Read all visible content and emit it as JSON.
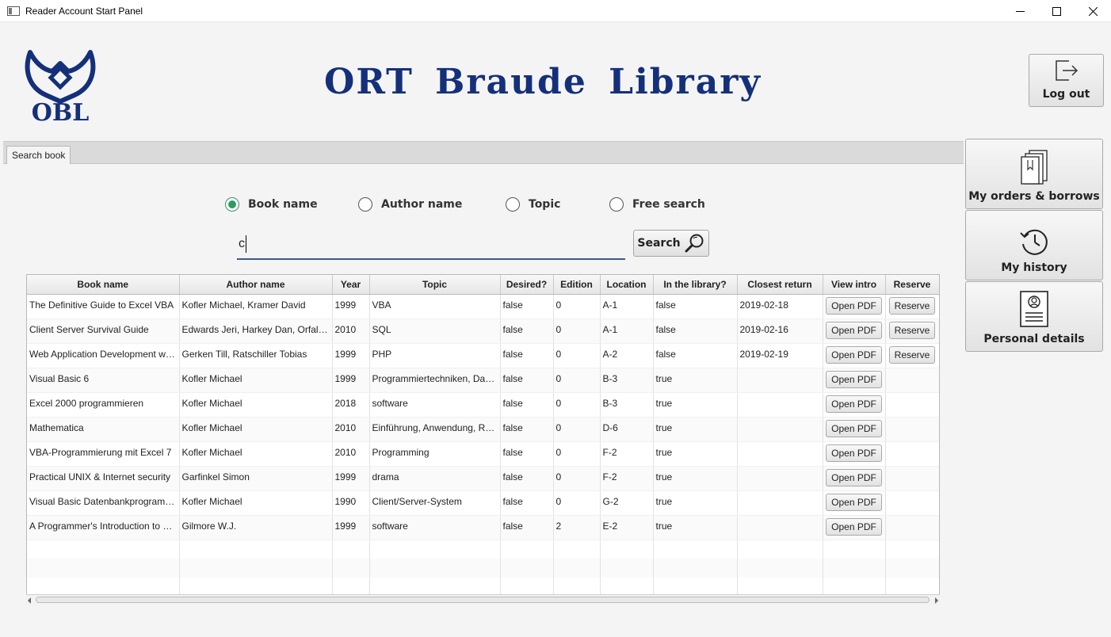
{
  "window": {
    "title": "Reader Account Start Panel"
  },
  "header": {
    "title": "ORT Braude Library",
    "logo_text": "OBL"
  },
  "buttons": {
    "logout": "Log out",
    "orders": "My orders & borrows",
    "history": "My history",
    "personal": "Personal details",
    "search": "Search"
  },
  "tab": {
    "label": "Search book"
  },
  "search": {
    "options": [
      "Book name",
      "Author name",
      "Topic",
      "Free search"
    ],
    "selected": "Book name",
    "query": "c"
  },
  "table": {
    "columns": [
      "Book name",
      "Author name",
      "Year",
      "Topic",
      "Desired?",
      "Edition",
      "Location",
      "In the library?",
      "Closest return",
      "View intro",
      "Reserve"
    ],
    "open_pdf_label": "Open PDF",
    "reserve_label": "Reserve",
    "rows": [
      [
        "The Definitive Guide to Excel VBA",
        "Kofler Michael, Kramer David",
        "1999",
        "VBA",
        "false",
        "0",
        "A-1",
        "false",
        "2019-02-18"
      ],
      [
        "Client Server Survival Guide",
        "Edwards Jeri, Harkey Dan, Orfali Robert",
        "2010",
        "SQL",
        "false",
        "0",
        "A-1",
        "false",
        "2019-02-16"
      ],
      [
        "Web Application Development with PHP",
        "Gerken Till, Ratschiller Tobias",
        "1999",
        "PHP",
        "false",
        "0",
        "A-2",
        "false",
        "2019-02-19"
      ],
      [
        "Visual Basic 6",
        "Kofler Michael",
        "1999",
        "Programmiertechniken, Datenbanken",
        "false",
        "0",
        "B-3",
        "true",
        ""
      ],
      [
        "Excel 2000 programmieren",
        "Kofler Michael",
        "2018",
        "software",
        "false",
        "0",
        "B-3",
        "true",
        ""
      ],
      [
        "Mathematica",
        "Kofler Michael",
        "2010",
        "Einführung, Anwendung, Referenz",
        "false",
        "0",
        "D-6",
        "true",
        ""
      ],
      [
        "VBA-Programmierung mit Excel 7",
        "Kofler Michael",
        "2010",
        "Programming",
        "false",
        "0",
        "F-2",
        "true",
        ""
      ],
      [
        "Practical UNIX & Internet security",
        "Garfinkel Simon",
        "1999",
        "drama",
        "false",
        "0",
        "F-2",
        "true",
        ""
      ],
      [
        "Visual Basic Datenbankprogrammierung",
        "Kofler Michael",
        "1990",
        "Client/Server-System",
        "false",
        "0",
        "G-2",
        "true",
        ""
      ],
      [
        "A Programmer's Introduction to Visual Basic",
        "Gilmore W.J.",
        "1999",
        "software",
        "false",
        "2",
        "E-2",
        "true",
        ""
      ]
    ],
    "reservable_rows": [
      true,
      true,
      true,
      false,
      false,
      false,
      false,
      false,
      false,
      false
    ]
  },
  "colors": {
    "title_blue": "#15307a",
    "radio_green": "#2e9a5e",
    "input_underline": "#3b5a8a"
  }
}
